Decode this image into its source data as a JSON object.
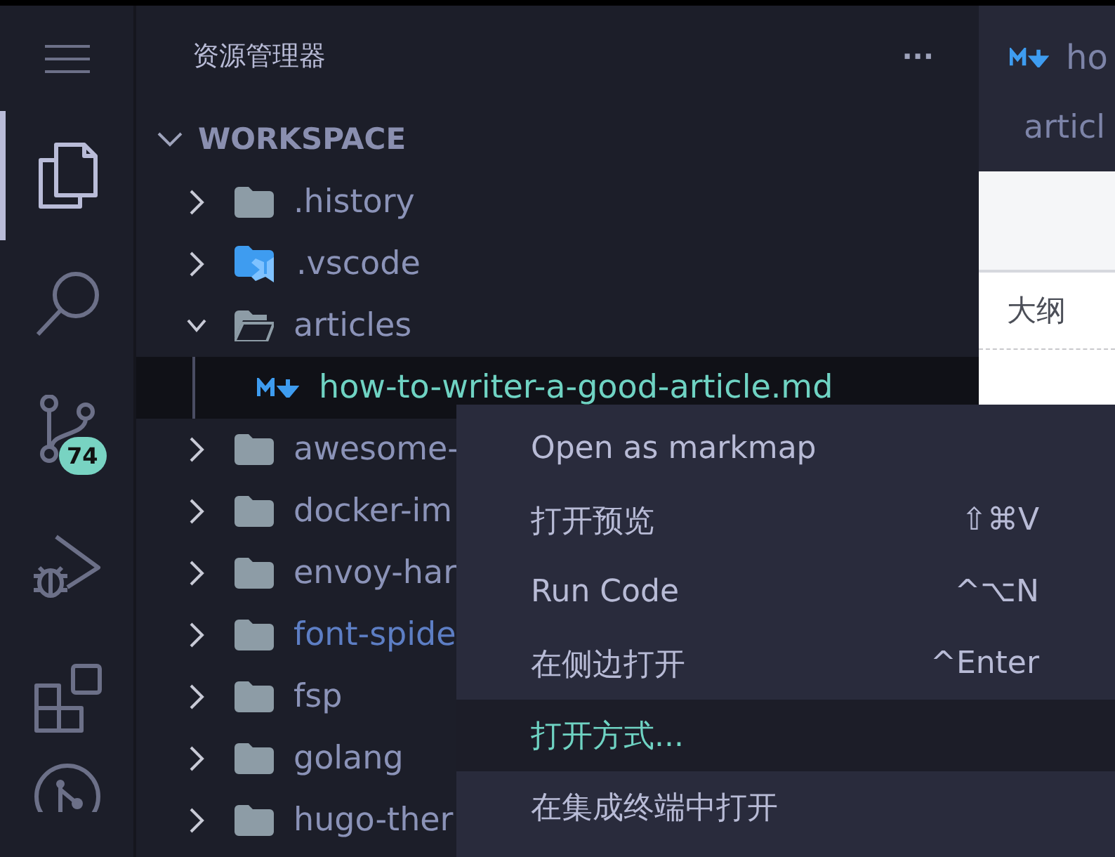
{
  "explorer": {
    "title": "资源管理器",
    "more": "···"
  },
  "activity_bar": {
    "badge": "74"
  },
  "workspace": {
    "title": "WORKSPACE",
    "expanded": true
  },
  "tree": [
    {
      "label": ".history",
      "kind": "folder",
      "expanded": false,
      "selected": false,
      "color": "#8b93b8"
    },
    {
      "label": ".vscode",
      "kind": "vscode-folder",
      "expanded": false,
      "selected": false,
      "color": "#8b93b8"
    },
    {
      "label": "articles",
      "kind": "folder",
      "expanded": true,
      "selected": false,
      "color": "#8b93b8",
      "children": [
        {
          "label": "how-to-writer-a-good-article.md",
          "kind": "markdown",
          "selected": true,
          "color": "#6fd3c3"
        }
      ]
    },
    {
      "label": "awesome-",
      "kind": "folder",
      "expanded": false,
      "selected": false,
      "color": "#8b93b8"
    },
    {
      "label": "docker-im",
      "kind": "folder",
      "expanded": false,
      "selected": false,
      "color": "#8b93b8"
    },
    {
      "label": "envoy-har",
      "kind": "folder",
      "expanded": false,
      "selected": false,
      "color": "#8b93b8"
    },
    {
      "label": "font-spide",
      "kind": "folder",
      "expanded": false,
      "selected": false,
      "color": "#5d7ec4"
    },
    {
      "label": "fsp",
      "kind": "folder",
      "expanded": false,
      "selected": false,
      "color": "#8b93b8"
    },
    {
      "label": "golang",
      "kind": "folder",
      "expanded": false,
      "selected": false,
      "color": "#8b93b8"
    },
    {
      "label": "hugo-ther",
      "kind": "folder",
      "expanded": false,
      "selected": false,
      "color": "#8b93b8"
    }
  ],
  "editor": {
    "tab": "ho",
    "breadcrumb": "articl",
    "outline_title": "大纲"
  },
  "context_menu": [
    {
      "label": "Open as markmap",
      "selected": false
    },
    {
      "label": "打开预览",
      "shortcut": "⇧⌘V",
      "selected": false
    },
    {
      "label": "Run Code",
      "shortcut": "^⌥N",
      "selected": false
    },
    {
      "label": "在侧边打开",
      "shortcut": "^Enter",
      "selected": false
    },
    {
      "label": "打开方式...",
      "selected": true
    },
    {
      "label": "在集成终端中打开",
      "selected": false
    }
  ]
}
